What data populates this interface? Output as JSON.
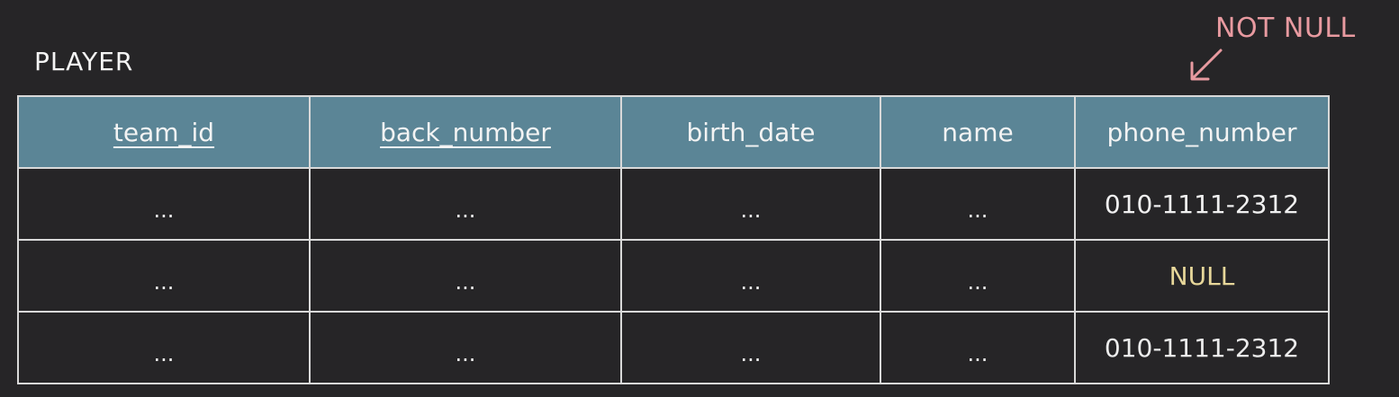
{
  "table_name": "PLAYER",
  "annotation": {
    "label": "NOT NULL",
    "color": "#e89aa0"
  },
  "columns": [
    {
      "label": "team_id",
      "primary_key": true
    },
    {
      "label": "back_number",
      "primary_key": true
    },
    {
      "label": "birth_date",
      "primary_key": false
    },
    {
      "label": "name",
      "primary_key": false
    },
    {
      "label": "phone_number",
      "primary_key": false
    }
  ],
  "rows": [
    [
      "...",
      "...",
      "...",
      "...",
      "010-1111-2312"
    ],
    [
      "...",
      "...",
      "...",
      "...",
      "NULL"
    ],
    [
      "...",
      "...",
      "...",
      "...",
      "010-1111-2312"
    ]
  ],
  "colors": {
    "header_bg": "#5b8596",
    "background": "#262527",
    "null_text": "#e7d79a"
  }
}
